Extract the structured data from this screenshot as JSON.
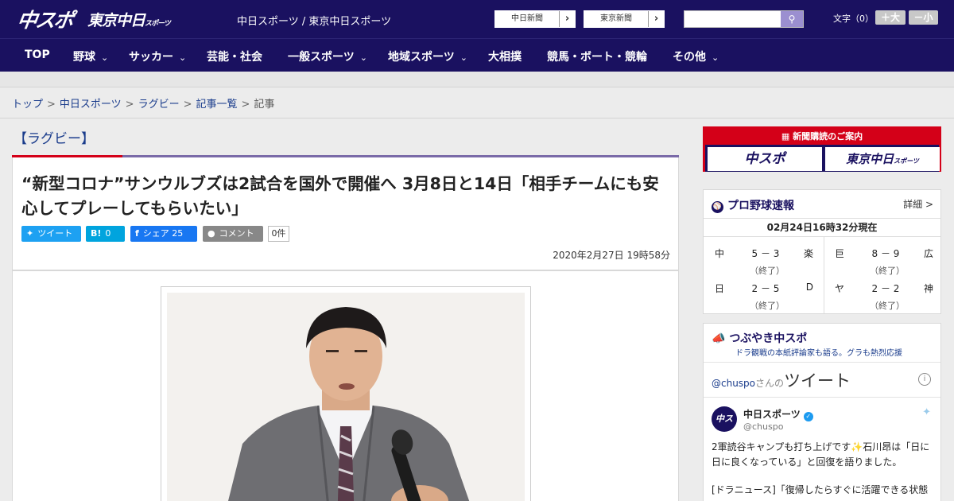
{
  "header": {
    "logo_chuspo": "中スポ",
    "logo_tokyo": "東京中日",
    "logo_tokyo_sub": "スポーツ",
    "site_name": "中日スポーツ / 東京中日スポーツ",
    "paper_links": [
      "中日新聞",
      "東京新聞"
    ],
    "search_placeholder": "",
    "font_size_label": "文字（0）",
    "font_larger": "＋大",
    "font_smaller": "－小"
  },
  "nav": {
    "items": [
      {
        "label": "TOP",
        "dropdown": false
      },
      {
        "label": "野球",
        "dropdown": true
      },
      {
        "label": "サッカー",
        "dropdown": true
      },
      {
        "label": "芸能・社会",
        "dropdown": false
      },
      {
        "label": "一般スポーツ",
        "dropdown": true
      },
      {
        "label": "地域スポーツ",
        "dropdown": true
      },
      {
        "label": "大相撲",
        "dropdown": false
      },
      {
        "label": "競馬・ボート・競輪",
        "dropdown": false
      },
      {
        "label": "その他",
        "dropdown": true
      }
    ]
  },
  "breadcrumb": {
    "items": [
      "トップ",
      "中日スポーツ",
      "ラグビー",
      "記事一覧"
    ],
    "current": "記事",
    "separator": ">"
  },
  "article": {
    "category": "【ラグビー】",
    "title": "“新型コロナ”サンウルブズは2試合を国外で開催へ 3月8日と14日「相手チームにも安心してプレーしてもらいたい」",
    "share": {
      "tweet": "ツイート",
      "hatena_count": "0",
      "facebook": "シェア 25",
      "comment": "コメント",
      "comment_count": "0件"
    },
    "date": "2020年2月27日 19時58分"
  },
  "sidebar": {
    "ad": {
      "heading": "新聞購読のご案内",
      "buttons": [
        "中スポ",
        "東京中日"
      ],
      "button_sub": "スポーツ"
    },
    "baseball": {
      "title": "プロ野球速報",
      "detail": "詳細 >",
      "timestamp": "02月24日16時32分現在",
      "games": [
        {
          "team1": "中",
          "score": "5 － 3",
          "team2": "楽",
          "status": "（終了）"
        },
        {
          "team1": "巨",
          "score": "8 － 9",
          "team2": "広",
          "status": "（終了）"
        },
        {
          "team1": "日",
          "score": "2 － 5",
          "team2": "D",
          "status": "（終了）"
        },
        {
          "team1": "ヤ",
          "score": "2 － 2",
          "team2": "神",
          "status": "（終了）"
        }
      ]
    },
    "twitter": {
      "title": "つぶやき中スポ",
      "subtitle": "ドラ観戦の本紙評論家も語る。グラも熱烈応援",
      "handle_prefix": "@chuspo",
      "handle_suffix": "さんの",
      "tweets_label": "ツイート",
      "account_name": "中日スポーツ",
      "account_handle": "@chuspo",
      "avatar_text": "中スポ",
      "tweet_text": "2軍読谷キャンプも打ち上げです✨石川昂は「日に日に良くなっている」と回復を語りました。",
      "tweet_text2": "[ドラニュース]「復帰したらすぐに活躍できる状態"
    }
  },
  "colors": {
    "brand_navy": "#1a1160",
    "accent_red": "#d40018",
    "link_blue": "#1a3c8c"
  }
}
